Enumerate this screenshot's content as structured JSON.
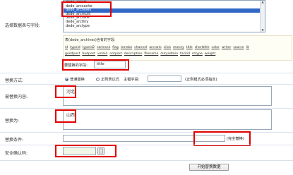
{
  "table_field": {
    "label": "选择数据表与字段:",
    "tables": [
      "dede_arcatt",
      "dede_arccache",
      "dede_archives",
      "dede_arcmulti",
      "dede_arcrank",
      "dede_arctiny",
      "dede_arctype"
    ],
    "selected": "dede_archives",
    "fields_title": "表(dede_archives)含有的字段:",
    "fields_row1": [
      "id",
      "typeid",
      "typeid2",
      "sortrank",
      "flag",
      "ismake",
      "channel",
      "arcrank",
      "click",
      "money",
      "title",
      "shorttitle",
      "color",
      "writer",
      "source",
      "lit"
    ],
    "fields_row2": [
      "goodpost",
      "badpost",
      "voteid",
      "notpost",
      "description",
      "filename",
      "dutyadmin",
      "tackid",
      "mtype",
      "weight"
    ],
    "replace_field_label": "要替换的字段:",
    "replace_field_value": "title"
  },
  "replace_mode": {
    "label": "替换方式:",
    "normal": "普通替换",
    "regex": "正则表达式",
    "key_field": "主键字段:",
    "regex_note": "(正则模式必须指定)"
  },
  "replace_content": {
    "label": "被替换内容:",
    "value": "河北"
  },
  "replace_with": {
    "label": "替换为:",
    "value": "山西"
  },
  "condition": {
    "label": "替换条件:",
    "checkbox_label": "完全替换"
  },
  "captcha": {
    "label": "安全确认码:"
  },
  "submit": {
    "label": "开始替换数据"
  },
  "colors": {
    "highlight_red": "#e00000",
    "selected_blue": "#3168c6"
  }
}
